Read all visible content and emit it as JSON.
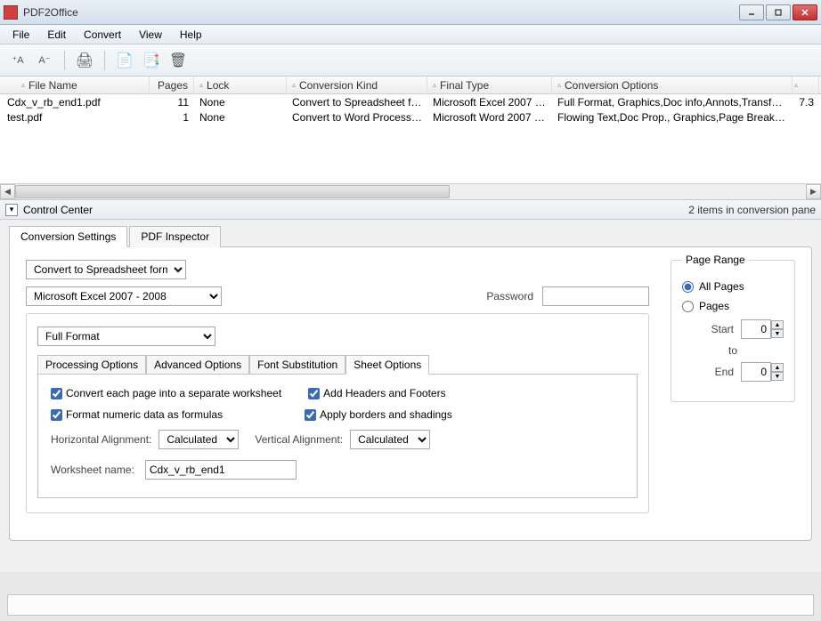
{
  "window": {
    "title": "PDF2Office"
  },
  "menu": {
    "file": "File",
    "edit": "Edit",
    "convert": "Convert",
    "view": "View",
    "help": "Help"
  },
  "table": {
    "headers": {
      "file": "File Name",
      "pages": "Pages",
      "lock": "Lock",
      "kind": "Conversion Kind",
      "final": "Final Type",
      "opts": "Conversion Options"
    },
    "rows": [
      {
        "file": "Cdx_v_rb_end1.pdf",
        "pages": "11",
        "lock": "None",
        "kind": "Convert to Spreadsheet format",
        "final": "Microsoft Excel 2007 - ...",
        "opts": "Full Format, Graphics,Doc info,Annots,Transformed t...",
        "extra": "7.3"
      },
      {
        "file": "test.pdf",
        "pages": "1",
        "lock": "None",
        "kind": "Convert to Word Processing file",
        "final": "Microsoft Word 2007 - ...",
        "opts": "Flowing Text,Doc Prop., Graphics,Page Break, Tabl...",
        "extra": ""
      }
    ]
  },
  "controlCenter": {
    "label": "Control Center",
    "status": "2 items in conversion pane"
  },
  "tabs": {
    "conversion": "Conversion Settings",
    "inspector": "PDF Inspector"
  },
  "settings": {
    "format_select": "Convert to Spreadsheet format",
    "app_select": "Microsoft Excel 2007 - 2008",
    "password_label": "Password",
    "layout_select": "Full Format",
    "inner_tabs": {
      "processing": "Processing Options",
      "advanced": "Advanced Options",
      "font": "Font Substitution",
      "sheet": "Sheet Options"
    },
    "sheet": {
      "convert_pages": "Convert each page into a separate worksheet",
      "add_headers": "Add Headers and Footers",
      "numeric_formulas": "Format numeric data as formulas",
      "apply_borders": "Apply borders and shadings",
      "halign_label": "Horizontal Alignment:",
      "valign_label": "Vertical Alignment:",
      "halign_value": "Calculated",
      "valign_value": "Calculated",
      "ws_label": "Worksheet name:",
      "ws_value": "Cdx_v_rb_end1"
    }
  },
  "pageRange": {
    "title": "Page Range",
    "all": "All Pages",
    "pages": "Pages",
    "start": "Start",
    "to": "to",
    "end": "End",
    "start_val": "0",
    "end_val": "0"
  }
}
